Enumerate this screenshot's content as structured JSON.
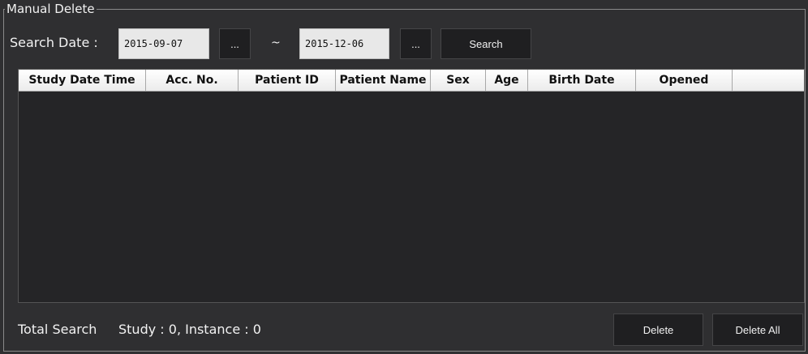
{
  "group": {
    "title": "Manual Delete"
  },
  "search": {
    "label": "Search Date :",
    "from_date": "2015-09-07",
    "to_date": "2015-12-06",
    "from_picker_label": "...",
    "to_picker_label": "...",
    "separator": "~",
    "search_button": "Search"
  },
  "grid": {
    "columns": [
      "Study Date Time",
      "Acc. No.",
      "Patient ID",
      "Patient Name",
      "Sex",
      "Age",
      "Birth Date",
      "Opened"
    ],
    "rows": []
  },
  "footer": {
    "total_label": "Total Search",
    "summary": "Study : 0, Instance : 0",
    "delete_button": "Delete",
    "delete_all_button": "Delete All"
  },
  "colors": {
    "background": "#2f2f31",
    "button": "#1f1f21",
    "grid_body": "#252527",
    "header": "#ffffff"
  }
}
